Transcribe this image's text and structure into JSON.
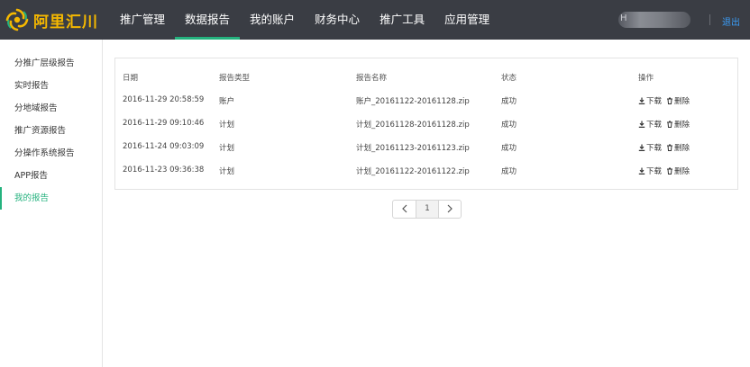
{
  "brand": {
    "name": "阿里汇川",
    "accent": "#f5b800",
    "active_color": "#24b27e"
  },
  "nav": {
    "items": [
      "推广管理",
      "数据报告",
      "我的账户",
      "财务中心",
      "推广工具",
      "应用管理"
    ],
    "active": "数据报告"
  },
  "user": {
    "initial": "H",
    "logout_label": "退出"
  },
  "sidebar": {
    "items": [
      "分推广层级报告",
      "实时报告",
      "分地域报告",
      "推广资源报告",
      "分操作系统报告",
      "APP报告",
      "我的报告"
    ],
    "active": "我的报告"
  },
  "table": {
    "headers": [
      "日期",
      "报告类型",
      "报告名称",
      "状态",
      "操作"
    ],
    "rows": [
      {
        "date": "2016-11-29 20:58:59",
        "type": "账户",
        "name": "账户_20161122-20161128.zip",
        "status": "成功"
      },
      {
        "date": "2016-11-29 09:10:46",
        "type": "计划",
        "name": "计划_20161128-20161128.zip",
        "status": "成功"
      },
      {
        "date": "2016-11-24 09:03:09",
        "type": "计划",
        "name": "计划_20161123-20161123.zip",
        "status": "成功"
      },
      {
        "date": "2016-11-23 09:36:38",
        "type": "计划",
        "name": "计划_20161122-20161122.zip",
        "status": "成功"
      }
    ],
    "action_download": "下载",
    "action_delete": "删除"
  },
  "pagination": {
    "prev_icon": "chevron-left-icon",
    "current": "1",
    "next_icon": "chevron-right-icon"
  }
}
